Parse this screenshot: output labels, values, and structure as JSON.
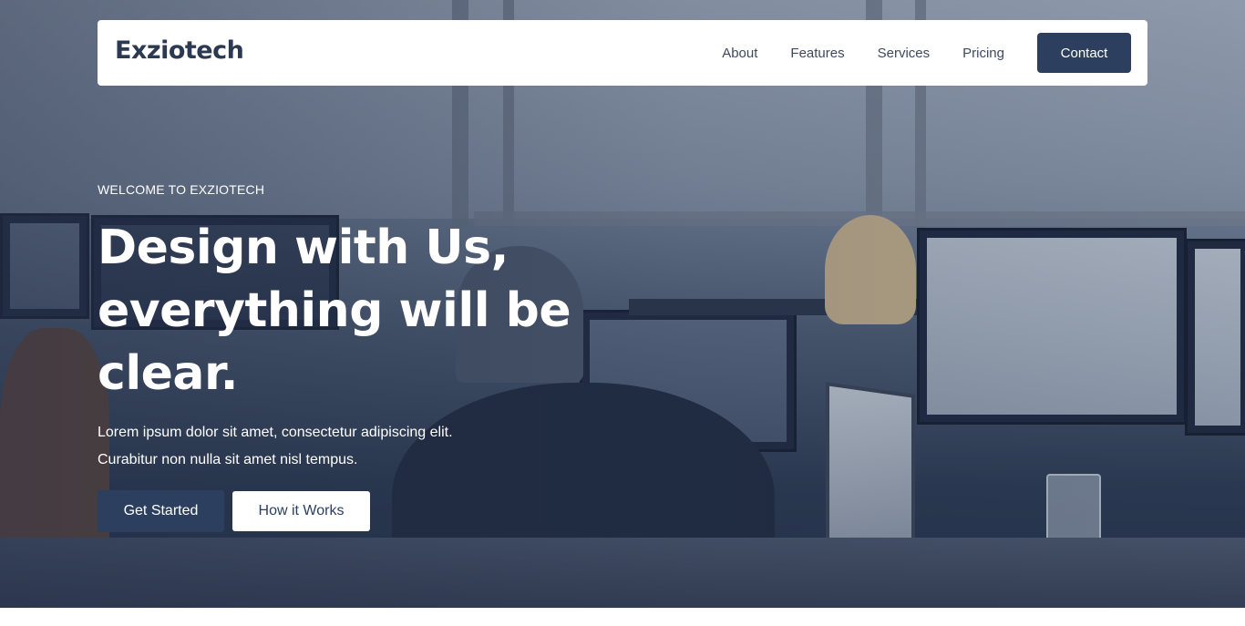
{
  "brand": {
    "name": "Exziotech"
  },
  "nav": {
    "links": [
      "About",
      "Features",
      "Services",
      "Pricing"
    ],
    "contact_label": "Contact"
  },
  "hero": {
    "eyebrow": "WELCOME TO EXZIOTECH",
    "headline": "Design with Us, everything will be clear.",
    "subtext_line1": "Lorem ipsum dolor sit amet, consectetur adipiscing elit.",
    "subtext_line2": "Curabitur non nulla sit amet nisl tempus.",
    "primary_cta": "Get Started",
    "secondary_cta": "How it Works",
    "background": "office-workspace-photo"
  },
  "colors": {
    "primary": "#2c3f5e",
    "text_on_dark": "#ffffff",
    "nav_text": "#3d4a5e"
  }
}
